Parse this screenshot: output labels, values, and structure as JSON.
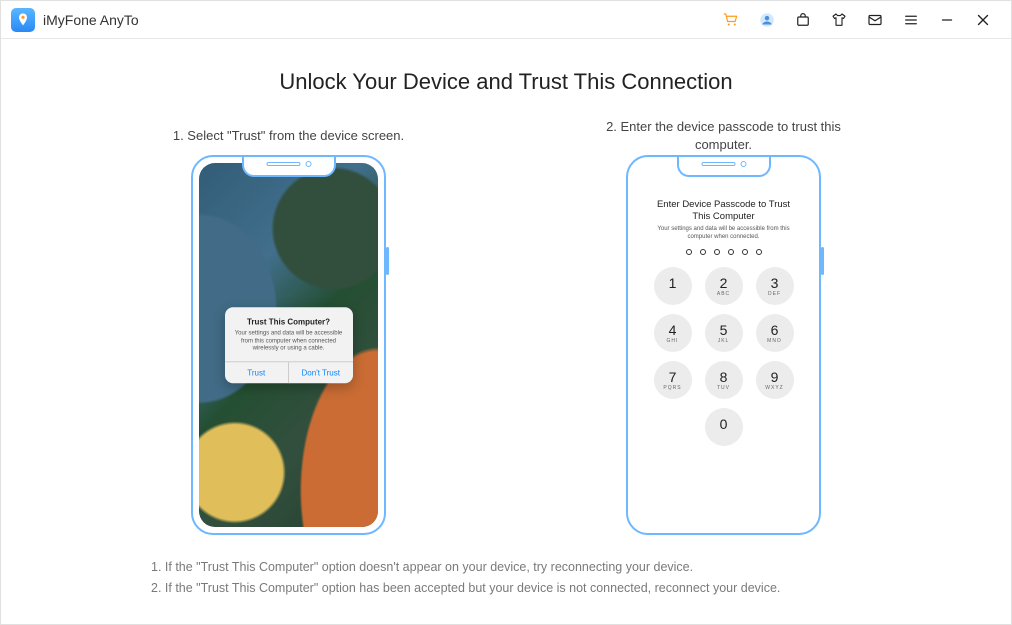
{
  "app": {
    "title": "iMyFone AnyTo"
  },
  "titlebar_icons": {
    "cart": "cart-icon",
    "user": "user-icon",
    "bag": "bag-icon",
    "shirt": "shirt-icon",
    "mail": "mail-icon",
    "menu": "menu-icon",
    "minimize": "minimize-icon",
    "close": "close-icon"
  },
  "main": {
    "heading": "Unlock Your Device and Trust This Connection",
    "step1_label": "1. Select \"Trust\" from the device screen.",
    "step2_label": "2. Enter the device passcode to trust this computer.",
    "trust_dialog": {
      "title": "Trust This Computer?",
      "body": "Your settings and data will be accessible from this computer when connected wirelessly or using a cable.",
      "btn_trust": "Trust",
      "btn_dont": "Don't Trust"
    },
    "passcode": {
      "title": "Enter Device Passcode to Trust This Computer",
      "subtitle": "Your settings and data will be accessible from this computer when connected.",
      "dots": 6,
      "keys": [
        {
          "num": "1",
          "letters": ""
        },
        {
          "num": "2",
          "letters": "ABC"
        },
        {
          "num": "3",
          "letters": "DEF"
        },
        {
          "num": "4",
          "letters": "GHI"
        },
        {
          "num": "5",
          "letters": "JKL"
        },
        {
          "num": "6",
          "letters": "MNO"
        },
        {
          "num": "7",
          "letters": "PQRS"
        },
        {
          "num": "8",
          "letters": "TUV"
        },
        {
          "num": "9",
          "letters": "WXYZ"
        },
        {
          "num": "0",
          "letters": ""
        }
      ]
    },
    "notes": {
      "n1": "1. If the \"Trust This Computer\" option doesn't appear on your device, try reconnecting your device.",
      "n2": "2. If the \"Trust This Computer\" option has been accepted but your device is not connected, reconnect your device."
    }
  }
}
